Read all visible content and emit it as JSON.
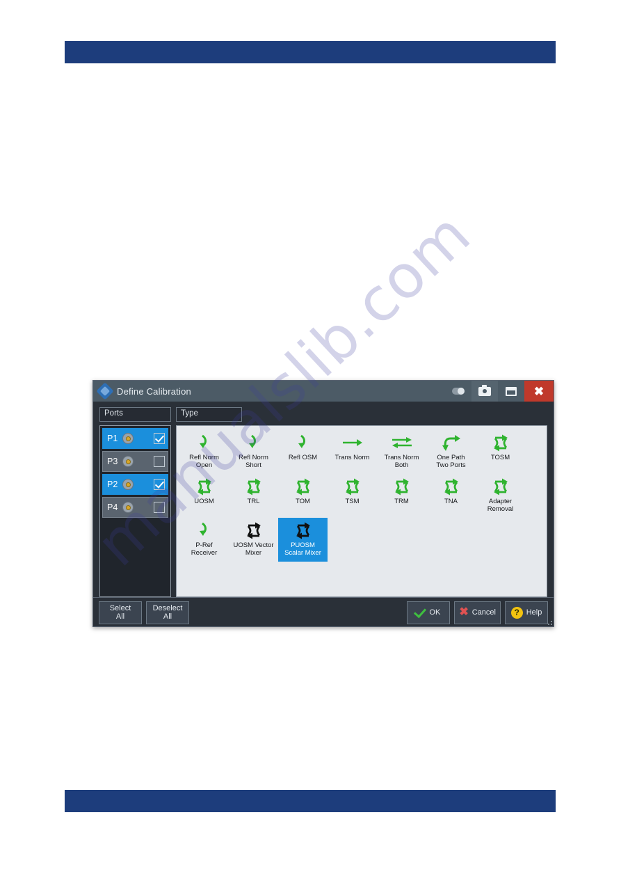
{
  "watermark": {
    "text": "manualslib.com"
  },
  "dialog": {
    "title": "Define Calibration",
    "titlebar_icons": {
      "toggle": "toggle-pill-icon",
      "screenshot": "camera-icon",
      "window": "restore-window-icon",
      "close": "close-x-icon"
    },
    "ports_label": "Ports",
    "type_label": "Type",
    "ports": [
      {
        "name": "P1",
        "selected": true,
        "checked": true,
        "connector": "coax-connector-icon"
      },
      {
        "name": "P3",
        "selected": false,
        "checked": false,
        "connector": "coax-connector-icon"
      },
      {
        "name": "P2",
        "selected": true,
        "checked": true,
        "connector": "coax-connector-icon"
      },
      {
        "name": "P4",
        "selected": false,
        "checked": false,
        "connector": "coax-connector-icon"
      }
    ],
    "cal_types": [
      [
        {
          "label": "Refl Norm\nOpen",
          "icon": "reflection-arrow-icon",
          "selected": false,
          "color": "#2fb32f"
        },
        {
          "label": "Refl Norm\nShort",
          "icon": "reflection-arrow-icon",
          "selected": false,
          "color": "#2fb32f"
        },
        {
          "label": "Refl OSM",
          "icon": "reflection-arrow-icon",
          "selected": false,
          "color": "#2fb32f"
        },
        {
          "label": "Trans Norm",
          "icon": "right-arrow-icon",
          "selected": false,
          "color": "#2fb32f"
        },
        {
          "label": "Trans Norm\nBoth",
          "icon": "bidirectional-arrows-icon",
          "selected": false,
          "color": "#2fb32f"
        },
        {
          "label": "One Path\nTwo Ports",
          "icon": "one-path-arrow-icon",
          "selected": false,
          "color": "#2fb32f"
        },
        {
          "label": "TOSM",
          "icon": "two-port-loop-icon",
          "selected": false,
          "color": "#2fb32f"
        }
      ],
      [
        {
          "label": "UOSM",
          "icon": "two-port-loop-icon",
          "selected": false,
          "color": "#2fb32f"
        },
        {
          "label": "TRL",
          "icon": "two-port-loop-icon",
          "selected": false,
          "color": "#2fb32f"
        },
        {
          "label": "TOM",
          "icon": "two-port-loop-icon",
          "selected": false,
          "color": "#2fb32f"
        },
        {
          "label": "TSM",
          "icon": "two-port-loop-icon",
          "selected": false,
          "color": "#2fb32f"
        },
        {
          "label": "TRM",
          "icon": "two-port-loop-icon",
          "selected": false,
          "color": "#2fb32f"
        },
        {
          "label": "TNA",
          "icon": "two-port-loop-icon",
          "selected": false,
          "color": "#2fb32f"
        },
        {
          "label": "Adapter\nRemoval",
          "icon": "two-port-loop-icon",
          "selected": false,
          "color": "#2fb32f"
        }
      ],
      [
        {
          "label": "P-Ref\nReceiver",
          "icon": "reflection-arrow-icon",
          "selected": false,
          "color": "#2fb32f"
        },
        {
          "label": "UOSM Vector\nMixer",
          "icon": "two-port-loop-icon",
          "selected": false,
          "color": "#111111"
        },
        {
          "label": "PUOSM\nScalar Mixer",
          "icon": "two-port-loop-icon",
          "selected": true,
          "color": "#111111"
        }
      ]
    ],
    "footer": {
      "select_all": "Select\nAll",
      "deselect_all": "Deselect\nAll",
      "ok": "OK",
      "cancel": "Cancel",
      "help": "Help"
    },
    "colors": {
      "accent_blue": "#1b8fdc",
      "icon_green": "#2fb32f",
      "close_red": "#c0392b",
      "band_blue": "#1d3d7c"
    }
  }
}
